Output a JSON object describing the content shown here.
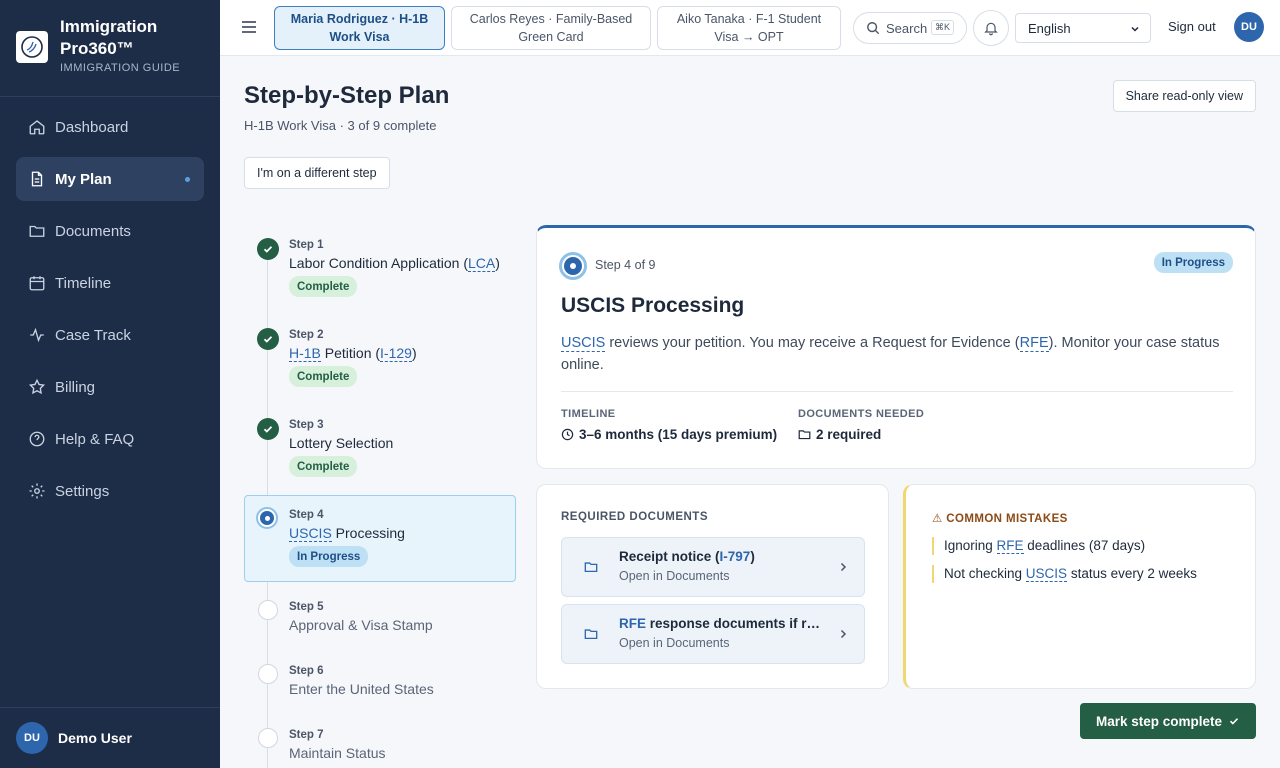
{
  "app": {
    "name_line1": "Immigration",
    "name_line2": "Pro360™",
    "subtitle": "IMMIGRATION GUIDE"
  },
  "sidebar": {
    "items": [
      {
        "label": "Dashboard",
        "icon": "home-icon"
      },
      {
        "label": "My Plan",
        "icon": "document-icon",
        "active": true
      },
      {
        "label": "Documents",
        "icon": "folder-icon"
      },
      {
        "label": "Timeline",
        "icon": "calendar-icon"
      },
      {
        "label": "Case Track",
        "icon": "activity-icon"
      },
      {
        "label": "Billing",
        "icon": "star-icon"
      },
      {
        "label": "Help & FAQ",
        "icon": "help-icon"
      },
      {
        "label": "Settings",
        "icon": "gear-icon"
      }
    ],
    "user": {
      "initials": "DU",
      "name": "Demo User"
    }
  },
  "topbar": {
    "cases": [
      {
        "line1": "Maria Rodriguez · H-1B",
        "line2": "Work Visa",
        "active": true
      },
      {
        "line1": "Carlos Reyes · Family-Based",
        "line2": "Green Card"
      },
      {
        "line1": "Aiko Tanaka · F-1 Student",
        "line2": "Visa → OPT"
      }
    ],
    "search_label": "Search",
    "search_shortcut": "⌘K",
    "language": "English",
    "sign_out": "Sign out",
    "avatar_initials": "DU"
  },
  "page": {
    "title": "Step-by-Step Plan",
    "subtitle": "H-1B Work Visa · 3 of 9 complete",
    "share_button": "Share read-only view",
    "different_step_button": "I'm on a different step"
  },
  "steps": [
    {
      "num": "Step 1",
      "pre": "Labor Condition Application (",
      "abbr": "LCA",
      "post": ")",
      "status": "Complete"
    },
    {
      "num": "Step 2",
      "abbr1": "H-1B",
      "mid": " Petition (",
      "abbr2": "I-129",
      "post": ")",
      "status": "Complete"
    },
    {
      "num": "Step 3",
      "name": "Lottery Selection",
      "status": "Complete"
    },
    {
      "num": "Step 4",
      "abbr": "USCIS",
      "post": " Processing",
      "status": "In Progress"
    },
    {
      "num": "Step 5",
      "name": "Approval & Visa Stamp"
    },
    {
      "num": "Step 6",
      "name": "Enter the United States"
    },
    {
      "num": "Step 7",
      "name": "Maintain Status"
    }
  ],
  "detail": {
    "step_label": "Step 4 of 9",
    "status": "In Progress",
    "title": "USCIS Processing",
    "desc_abbr1": "USCIS",
    "desc_part1": " reviews your petition. You may receive a Request for Evidence (",
    "desc_abbr2": "RFE",
    "desc_part2": "). Monitor your case status online.",
    "timeline_label": "TIMELINE",
    "timeline_value": "3–6 months (15 days premium)",
    "docs_label": "DOCUMENTS NEEDED",
    "docs_value": "2 required"
  },
  "required_docs": {
    "label": "REQUIRED DOCUMENTS",
    "items": [
      {
        "pre": "Receipt notice (",
        "abbr": "I-797",
        "post": ")",
        "sub": "Open in Documents"
      },
      {
        "abbr": "RFE",
        "post": " response documents if requested",
        "sub": "Open in Documents"
      }
    ]
  },
  "mistakes": {
    "label": "⚠ COMMON MISTAKES",
    "items": [
      {
        "pre": "Ignoring ",
        "abbr": "RFE",
        "post": " deadlines (87 days)"
      },
      {
        "pre": "Not checking ",
        "abbr": "USCIS",
        "post": " status every 2 weeks"
      }
    ]
  },
  "mark_complete": "Mark step complete",
  "colors": {
    "sidebar_bg": "#1d2d47",
    "accent": "#2e66ad",
    "success": "#245e45",
    "warning": "#f1d772"
  }
}
